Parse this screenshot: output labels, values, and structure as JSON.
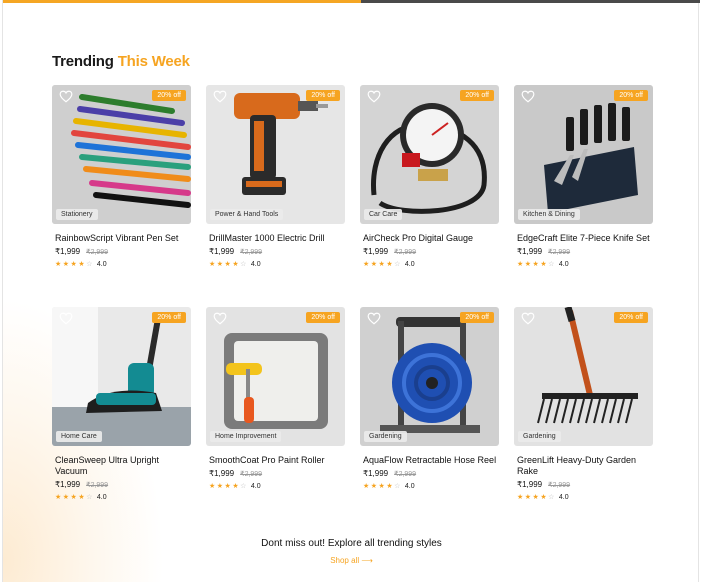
{
  "section": {
    "title_main": "Trending",
    "title_accent": "This Week"
  },
  "colors": {
    "accent": "#f6a421"
  },
  "products": [
    {
      "name": "RainbowScript Vibrant Pen Set",
      "category": "Stationery",
      "discount": "20% off",
      "price": "₹1,999",
      "mrp": "₹2,999",
      "rating": "4.0",
      "stars": 4
    },
    {
      "name": "DrillMaster 1000 Electric Drill",
      "category": "Power & Hand Tools",
      "discount": "20% off",
      "price": "₹1,999",
      "mrp": "₹2,999",
      "rating": "4.0",
      "stars": 4
    },
    {
      "name": "AirCheck Pro Digital Gauge",
      "category": "Car Care",
      "discount": "20% off",
      "price": "₹1,999",
      "mrp": "₹2,999",
      "rating": "4.0",
      "stars": 4
    },
    {
      "name": "EdgeCraft Elite 7-Piece Knife Set",
      "category": "Kitchen & Dining",
      "discount": "20% off",
      "price": "₹1,999",
      "mrp": "₹2,999",
      "rating": "4.0",
      "stars": 4
    },
    {
      "name": "CleanSweep Ultra Upright Vacuum",
      "category": "Home Care",
      "discount": "20% off",
      "price": "₹1,999",
      "mrp": "₹2,999",
      "rating": "4.0",
      "stars": 4
    },
    {
      "name": "SmoothCoat Pro Paint Roller",
      "category": "Home Improvement",
      "discount": "20% off",
      "price": "₹1,999",
      "mrp": "₹2,999",
      "rating": "4.0",
      "stars": 4
    },
    {
      "name": "AquaFlow Retractable Hose Reel",
      "category": "Gardening",
      "discount": "20% off",
      "price": "₹1,999",
      "mrp": "₹2,999",
      "rating": "4.0",
      "stars": 4
    },
    {
      "name": "GreenLift Heavy-Duty Garden Rake",
      "category": "Gardening",
      "discount": "20% off",
      "price": "₹1,999",
      "mrp": "₹2,999",
      "rating": "4.0",
      "stars": 4
    }
  ],
  "footer": {
    "cta": "Dont miss out! Explore all trending styles",
    "link": "Shop all"
  }
}
